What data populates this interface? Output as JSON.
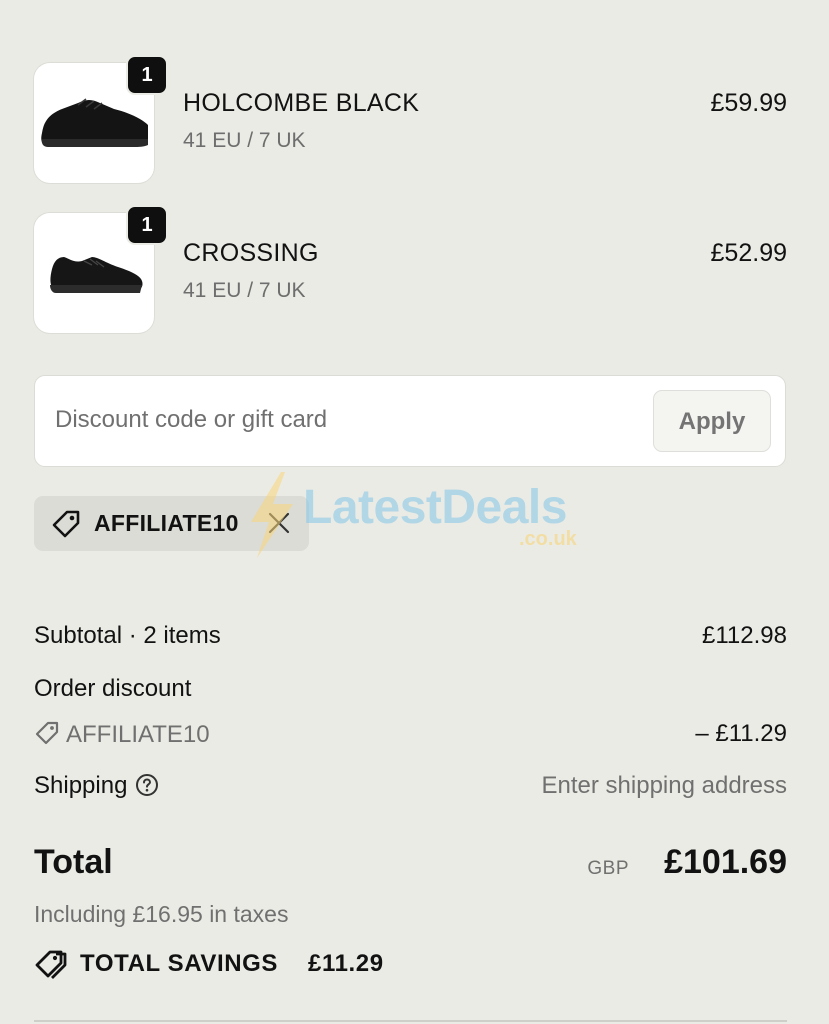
{
  "line_items": [
    {
      "name": "HOLCOMBE BLACK",
      "variant": "41 EU / 7 UK",
      "price": "£59.99",
      "quantity": "1",
      "image_icon": "sneaker-icon"
    },
    {
      "name": "CROSSING",
      "variant": "41 EU / 7 UK",
      "price": "£52.99",
      "quantity": "1",
      "image_icon": "running-shoe-icon"
    }
  ],
  "discount": {
    "placeholder": "Discount code or gift card",
    "apply_label": "Apply",
    "applied_code": "AFFILIATE10"
  },
  "watermark": {
    "text": "LatestDeals",
    "sub": ".co.uk"
  },
  "summary": {
    "subtotal_label": "Subtotal · 2 items",
    "subtotal_value": "£112.98",
    "order_discount_label": "Order discount",
    "discount_code": "AFFILIATE10",
    "discount_value": "– £11.29",
    "shipping_label": "Shipping",
    "shipping_value": "Enter shipping address"
  },
  "total": {
    "label": "Total",
    "currency": "GBP",
    "value": "£101.69",
    "taxes_note": "Including £16.95 in taxes",
    "savings_label": "TOTAL SAVINGS",
    "savings_value": "£11.29"
  },
  "colors": {
    "background": "#ebebe5",
    "text": "#121212",
    "muted": "#707070",
    "badge": "#0f0f0f"
  }
}
